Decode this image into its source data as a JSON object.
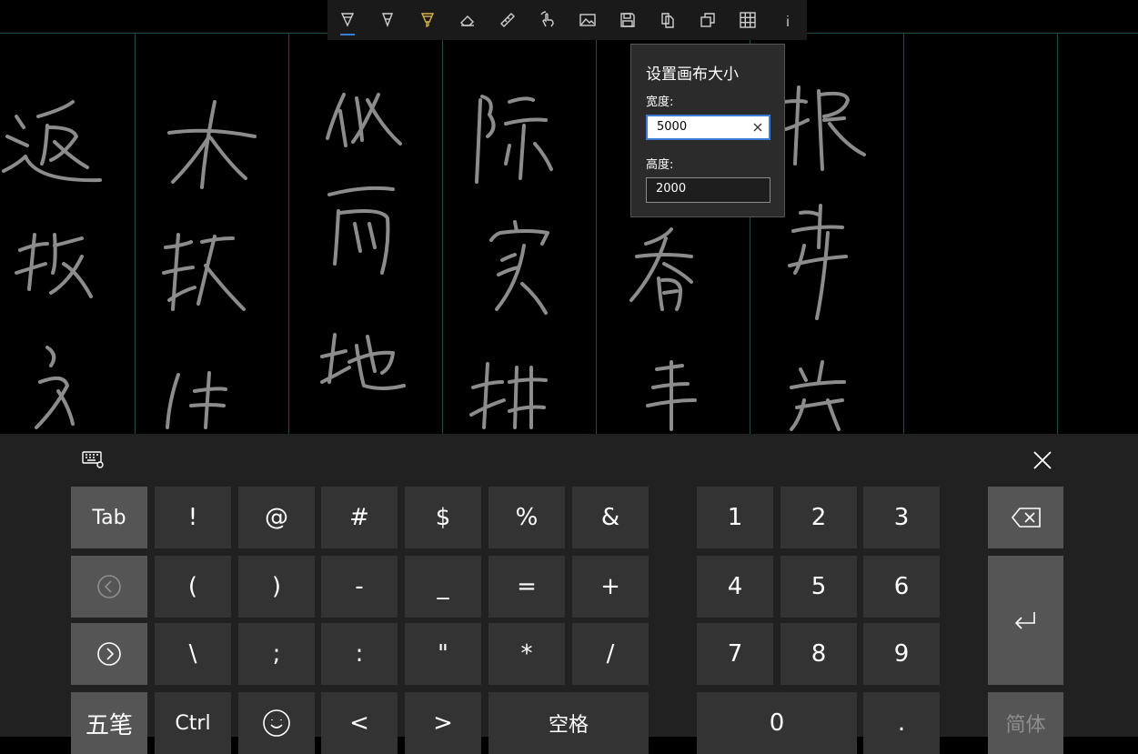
{
  "toolbar": {
    "items": [
      {
        "icon": "pen-icon",
        "selected": true
      },
      {
        "icon": "pencil-icon"
      },
      {
        "icon": "highlighter-icon",
        "color": "#d9b24a"
      },
      {
        "icon": "eraser-icon"
      },
      {
        "icon": "ruler-icon"
      },
      {
        "icon": "touch-hand-icon"
      },
      {
        "icon": "image-icon"
      },
      {
        "icon": "save-icon"
      },
      {
        "icon": "copy-icon"
      },
      {
        "icon": "canvas-size-icon"
      },
      {
        "icon": "grid-icon"
      },
      {
        "icon": "info-icon"
      }
    ],
    "accent_color": "#3a7bd5"
  },
  "dialog": {
    "title": "设置画布大小",
    "width_label": "宽度:",
    "width_value": "5000",
    "height_label": "高度:",
    "height_value": "2000"
  },
  "keyboard": {
    "rows": [
      [
        "Tab",
        "!",
        "@",
        "#",
        "$",
        "%",
        "&"
      ],
      [
        "",
        "(",
        ")",
        "-",
        "_",
        "=",
        "+"
      ],
      [
        "",
        "\\",
        ";",
        ":",
        "\"",
        "*",
        "/"
      ],
      [
        "五笔",
        "Ctrl",
        "",
        "<",
        ">",
        "空格"
      ]
    ],
    "numpad": [
      [
        "1",
        "2",
        "3"
      ],
      [
        "4",
        "5",
        "6"
      ],
      [
        "7",
        "8",
        "9"
      ],
      [
        "0",
        "."
      ]
    ],
    "backspace_icon": "backspace-icon",
    "enter_icon": "enter-icon",
    "lang_key": "简体",
    "close_icon": "close-icon",
    "settings_icon": "keyboard-settings-icon"
  },
  "canvas": {
    "grid_color": "#1f4a4a",
    "ink_color": "#8c8c8c"
  }
}
